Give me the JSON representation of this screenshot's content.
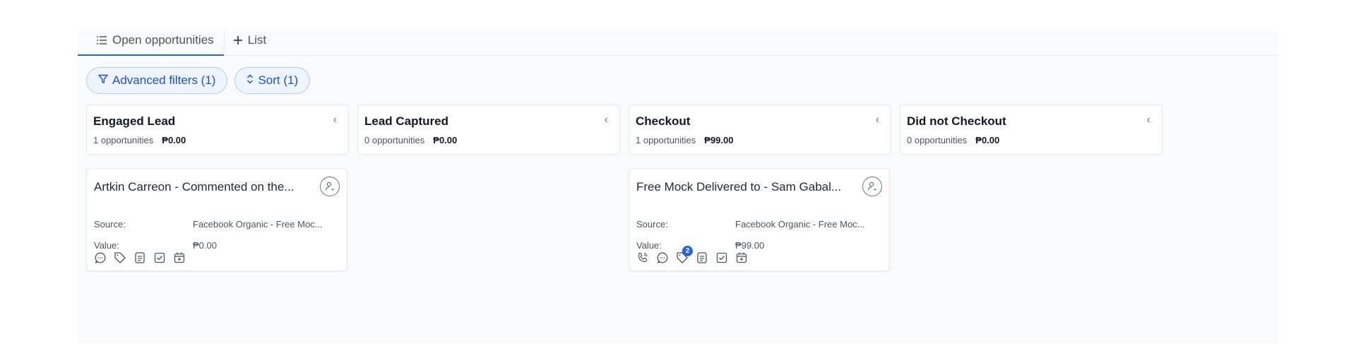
{
  "tabs": [
    {
      "label": "Open opportunities"
    },
    {
      "label": "List"
    }
  ],
  "filters": {
    "advanced_label": "Advanced filters (1)",
    "sort_label": "Sort (1)"
  },
  "columns": [
    {
      "title": "Engaged Lead",
      "count": "1 opportunities",
      "amount": "₱0.00"
    },
    {
      "title": "Lead Captured",
      "count": "0 opportunities",
      "amount": "₱0.00"
    },
    {
      "title": "Checkout",
      "count": "1 opportunities",
      "amount": "₱99.00"
    },
    {
      "title": "Did not Checkout",
      "count": "0 opportunities",
      "amount": "₱0.00"
    }
  ],
  "cards": [
    {
      "title": "Artkin Carreon - Commented on the...",
      "source_label": "Source:",
      "source": "Facebook Organic - Free Moc...",
      "value_label": "Value:",
      "value": "₱0.00",
      "icons": [
        "comment-icon",
        "tag-icon",
        "notes-icon",
        "task-icon",
        "calendar-icon"
      ]
    },
    {
      "title": "Free Mock Delivered to - Sam Gabal...",
      "source_label": "Source:",
      "source": "Facebook Organic - Free Moc...",
      "value_label": "Value:",
      "value": "₱99.00",
      "icons": [
        "phone-icon",
        "comment-icon",
        "tag-icon",
        "notes-icon",
        "task-icon",
        "calendar-icon"
      ],
      "tag_badge": "2"
    }
  ],
  "colors": {
    "accent": "#2563eb",
    "pill_bg": "#eef4fd",
    "board_bg": "#f8fafc"
  }
}
